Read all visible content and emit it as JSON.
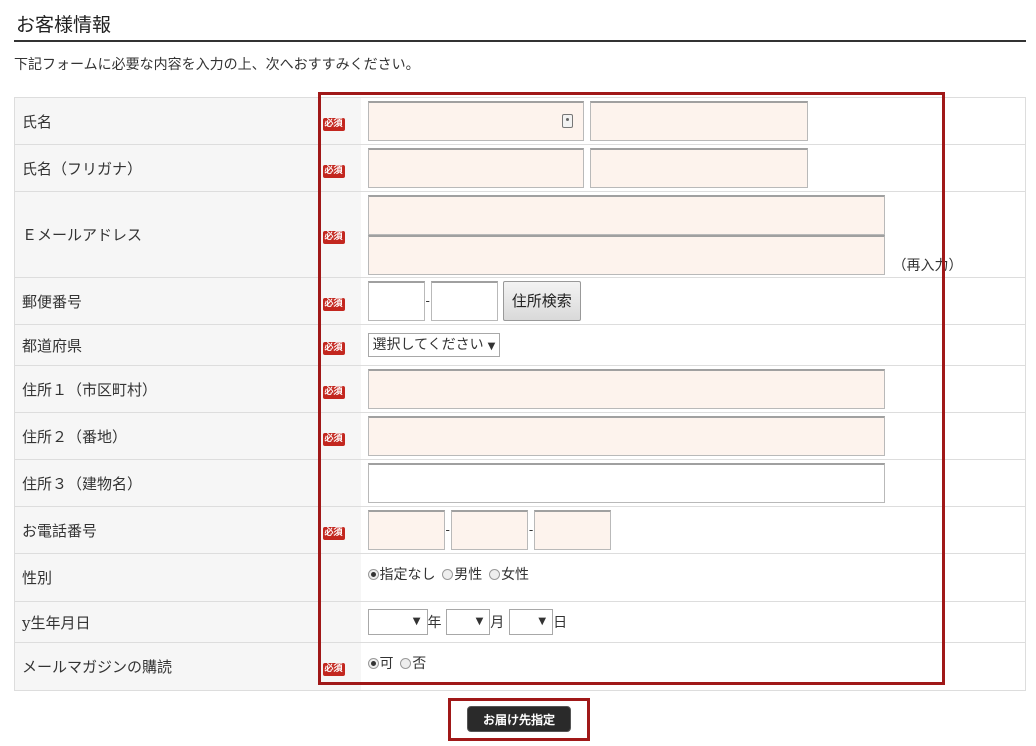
{
  "section_title": "お客様情報",
  "intro": "下記フォームに必要な内容を入力の上、次へおすすみください。",
  "required_badge": "必須",
  "rows": {
    "name": {
      "label": "氏名"
    },
    "kana": {
      "label": "氏名（フリガナ）"
    },
    "email": {
      "label": "Ｅメールアドレス",
      "reinput": "（再入力）"
    },
    "zip": {
      "label": "郵便番号",
      "dash": "-",
      "search_button": "住所検索"
    },
    "pref": {
      "label": "都道府県",
      "selected": "選択してください"
    },
    "addr1": {
      "label": "住所１（市区町村）"
    },
    "addr2": {
      "label": "住所２（番地）"
    },
    "addr3": {
      "label": "住所３（建物名）"
    },
    "tel": {
      "label": "お電話番号",
      "dash": "-"
    },
    "gender": {
      "label": "性別",
      "options": [
        "指定なし",
        "男性",
        "女性"
      ],
      "selected": "指定なし"
    },
    "birth": {
      "label": "y生年月日",
      "year_unit": "年",
      "month_unit": "月",
      "day_unit": "日"
    },
    "magazine": {
      "label": "メールマガジンの購読",
      "options": [
        "可",
        "否"
      ],
      "selected": "可"
    }
  },
  "submit_button": "お届け先指定",
  "colors": {
    "input_bg": "#fdf3ed",
    "badge": "#c3271f",
    "highlight": "#a01818"
  }
}
